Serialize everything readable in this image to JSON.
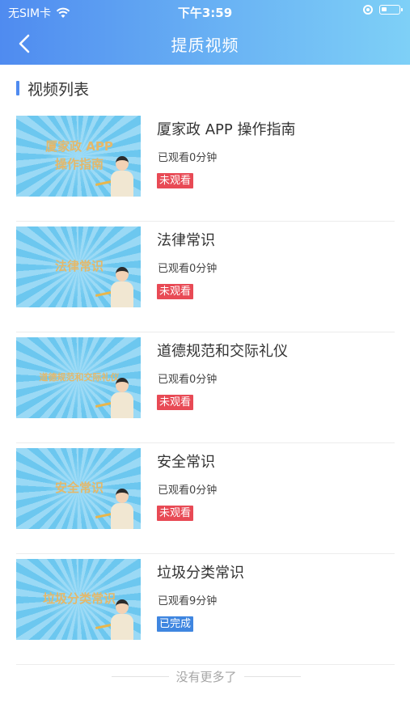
{
  "status_bar": {
    "carrier": "无SIM卡",
    "time": "下午3:59"
  },
  "nav": {
    "title": "提质视频",
    "back_icon": "chevron-left-icon"
  },
  "section": {
    "title": "视频列表"
  },
  "videos": [
    {
      "thumb_line1": "厦家政 APP",
      "thumb_line2": "操作指南",
      "title": "厦家政 APP 操作指南",
      "progress": "已观看0分钟",
      "status": "未观看"
    },
    {
      "thumb_line1": "法律常识",
      "thumb_line2": "",
      "title": "法律常识",
      "progress": "已观看0分钟",
      "status": "未观看"
    },
    {
      "thumb_line1": "道德规范和交际礼仪",
      "thumb_line2": "",
      "title": "道德规范和交际礼仪",
      "progress": "已观看0分钟",
      "status": "未观看"
    },
    {
      "thumb_line1": "安全常识",
      "thumb_line2": "",
      "title": "安全常识",
      "progress": "已观看0分钟",
      "status": "未观看"
    },
    {
      "thumb_line1": "垃圾分类常识",
      "thumb_line2": "",
      "title": "垃圾分类常识",
      "progress": "已观看9分钟",
      "status": "已完成"
    }
  ],
  "footer": {
    "text": "没有更多了"
  },
  "colors": {
    "header_start": "#4f8bf0",
    "header_end": "#7ed0f7",
    "unwatched_badge": "#e84a55",
    "done_badge": "#3f86e0"
  }
}
